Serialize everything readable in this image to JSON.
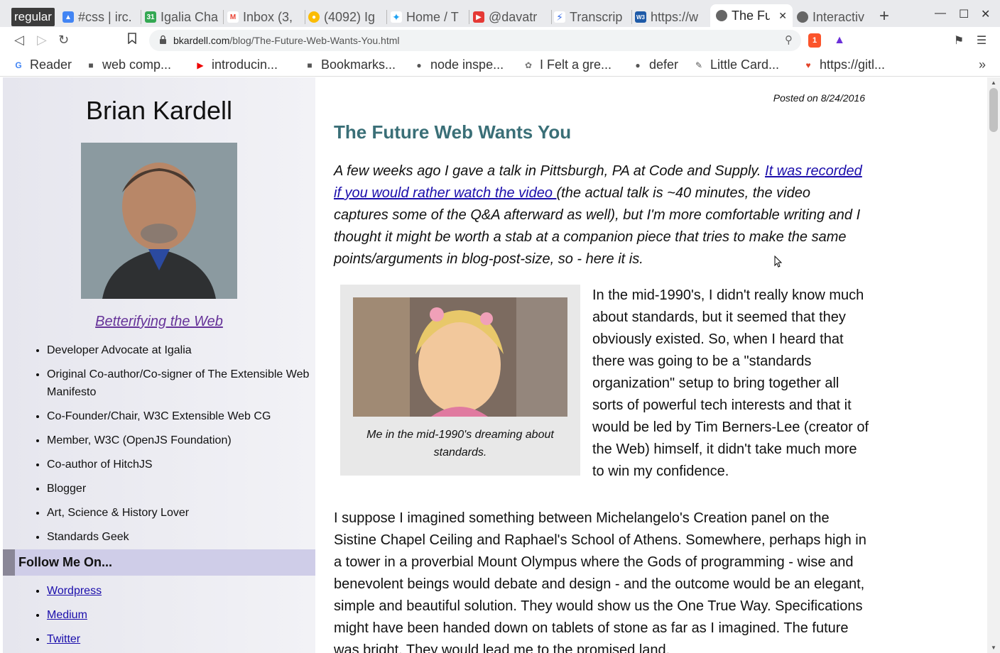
{
  "browser": {
    "tab_group_label": "regular",
    "tabs": [
      {
        "title": "#css | irc.",
        "icon": "chat-icon",
        "color": "#4285f4"
      },
      {
        "title": "Igalia Cha",
        "icon": "calendar-icon",
        "color": "#34a853"
      },
      {
        "title": "Inbox (3,",
        "icon": "gmail-icon",
        "color": "#ea4335"
      },
      {
        "title": "(4092) Ig",
        "icon": "chat-icon",
        "color": "#fbbc04"
      },
      {
        "title": "Home / T",
        "icon": "twitter-icon",
        "color": "#1da1f2"
      },
      {
        "title": "@davatr",
        "icon": "video-icon",
        "color": "#e53935"
      },
      {
        "title": "Transcrip",
        "icon": "bolt-icon",
        "color": "#3b6ee8"
      },
      {
        "title": "https://w",
        "icon": "w3c-icon",
        "color": "#1e5aa8"
      },
      {
        "title": "The Fu",
        "icon": "globe-icon",
        "color": "#666666",
        "active": true
      },
      {
        "title": "Interactiv",
        "icon": "globe-icon",
        "color": "#666666"
      }
    ],
    "url_host": "bkardell.com",
    "url_path": "/blog/The-Future-Web-Wants-You.html",
    "extension_badge": "1",
    "bookmarks": [
      {
        "label": "Reader",
        "icon": "google-icon"
      },
      {
        "label": "web comp...",
        "icon": "folder-icon"
      },
      {
        "label": "introducin...",
        "icon": "youtube-icon"
      },
      {
        "label": "Bookmarks...",
        "icon": "folder-icon"
      },
      {
        "label": "node inspe...",
        "icon": "globe-icon"
      },
      {
        "label": "I Felt a gre...",
        "icon": "paw-icon"
      },
      {
        "label": "defer",
        "icon": "globe-icon"
      },
      {
        "label": "Little Card...",
        "icon": "dog-icon"
      },
      {
        "label": "https://gitl...",
        "icon": "gitlab-icon"
      }
    ]
  },
  "sidebar": {
    "name": "Brian Kardell",
    "tagline": "Betterifying the Web",
    "roles": [
      "Developer Advocate at Igalia",
      "Original Co-author/Co-signer of The Extensible Web Manifesto",
      "Co-Founder/Chair, W3C Extensible Web CG",
      "Member, W3C (OpenJS Foundation)",
      "Co-author of HitchJS",
      "Blogger",
      "Art, Science & History Lover",
      "Standards Geek"
    ],
    "follow_heading": "Follow Me On...",
    "follow_links": [
      "Wordpress",
      "Medium",
      "Twitter"
    ]
  },
  "article": {
    "posted": "Posted on 8/24/2016",
    "title": "The Future Web Wants You",
    "intro_before": "A few weeks ago I gave a talk in Pittsburgh, PA at Code and Supply. ",
    "intro_link": "It was recorded if you would rather watch the video ",
    "intro_after": "(the actual talk is ~40 minutes, the video captures some of the Q&A afterward as well), but I'm more comfortable writing and I thought it might be worth a stab at a companion piece that tries to make the same points/arguments in blog-post-size, so - here it is.",
    "figure_caption": "Me in the mid-1990's dreaming about standards.",
    "paragraph1": "In the mid-1990's, I didn't really know much about standards, but it seemed that they obviously existed. So, when I heard that there was going to be a \"standards organization\" setup to bring together all sorts of powerful tech interests and that it would be led by Tim Berners-Lee (creator of the Web) himself, it didn't take much more to win my confidence.",
    "paragraph2": "I suppose I imagined something between Michelangelo's Creation panel on the Sistine Chapel Ceiling and Raphael's School of Athens. Somewhere, perhaps high in a tower in a proverbial Mount Olympus where the Gods of programming - wise and benevolent beings would debate and design - and the outcome would be an elegant, simple and beautiful solution. They would show us the One True Way. Specifications might have been handed down on tablets of stone as far as I imagined. The future was bright. They would lead me to the promised land."
  }
}
